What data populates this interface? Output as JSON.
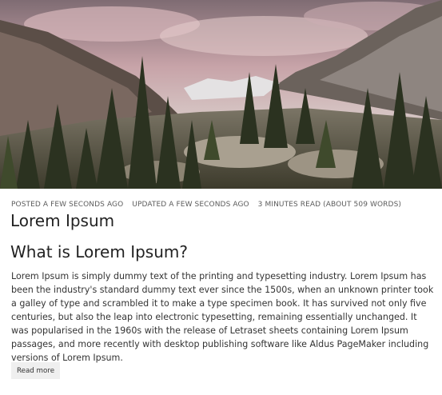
{
  "post": {
    "hero_image": "mountain-forest-landscape",
    "meta": {
      "posted": "POSTED A FEW SECONDS AGO",
      "updated": "UPDATED A FEW SECONDS AGO",
      "read_time": "3 MINUTES READ (ABOUT 509 WORDS)"
    },
    "title": "Lorem Ipsum",
    "section_heading": "What is Lorem Ipsum?",
    "body": "Lorem Ipsum is simply dummy text of the printing and typesetting industry. Lorem Ipsum has been the industry's standard dummy text ever since the 1500s, when an unknown printer took a galley of type and scrambled it to make a type specimen book. It has survived not only five centuries, but also the leap into electronic typesetting, remaining essentially unchanged. It was popularised in the 1960s with the release of Letraset sheets containing Lorem Ipsum passages, and more recently with desktop publishing software like Aldus PageMaker including versions of Lorem Ipsum.",
    "read_more_label": "Read more"
  }
}
